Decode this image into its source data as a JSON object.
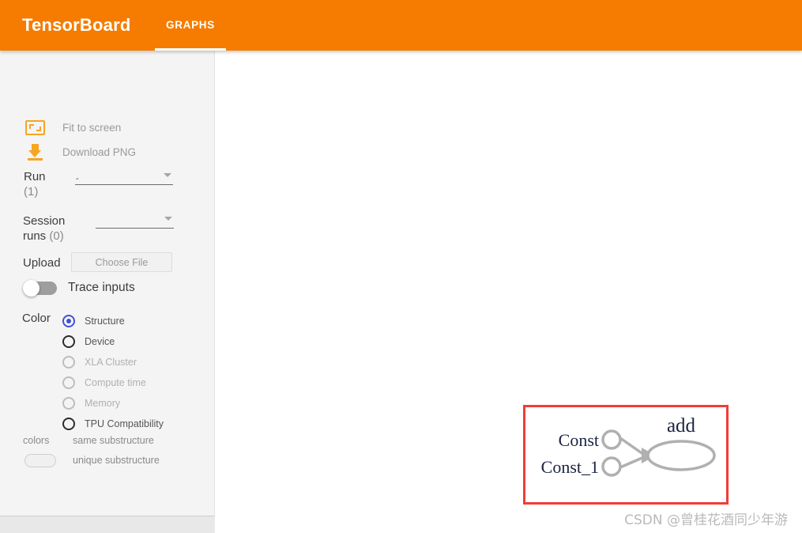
{
  "header": {
    "brand": "TensorBoard",
    "tabs": [
      {
        "label": "GRAPHS",
        "active": true
      }
    ]
  },
  "sidebar": {
    "actions": [
      {
        "label": "Fit to screen",
        "icon": "fit-to-screen-icon"
      },
      {
        "label": "Download PNG",
        "icon": "download-icon"
      }
    ],
    "run": {
      "label": "Run",
      "count": "(1)",
      "value": "-",
      "caret": "chevron-down-icon"
    },
    "session_runs": {
      "label": "Session",
      "label2": "runs",
      "count": "(0)",
      "value": "",
      "caret": "chevron-down-icon"
    },
    "upload": {
      "label": "Upload",
      "button": "Choose File"
    },
    "trace_inputs": {
      "label": "Trace inputs",
      "enabled": false
    },
    "color": {
      "label": "Color",
      "options": [
        {
          "label": "Structure",
          "selected": true,
          "disabled": false
        },
        {
          "label": "Device",
          "selected": false,
          "disabled": false
        },
        {
          "label": "XLA Cluster",
          "selected": false,
          "disabled": true
        },
        {
          "label": "Compute time",
          "selected": false,
          "disabled": true
        },
        {
          "label": "Memory",
          "selected": false,
          "disabled": true
        },
        {
          "label": "TPU Compatibility",
          "selected": false,
          "disabled": false
        }
      ],
      "accent": "#3f51d5"
    },
    "legend": {
      "label": "colors",
      "same": "same substructure",
      "unique": "unique substructure"
    }
  },
  "graph": {
    "highlight_color": "#f43b36",
    "nodes": [
      {
        "name": "Const",
        "shape": "circle",
        "label": "Const"
      },
      {
        "name": "Const_1",
        "shape": "circle",
        "label": "Const_1"
      },
      {
        "name": "add",
        "shape": "ellipse",
        "label": "add"
      }
    ],
    "edges": [
      {
        "from": "Const",
        "to": "add"
      },
      {
        "from": "Const_1",
        "to": "add"
      }
    ],
    "node_stroke": "#b0b0b0"
  },
  "watermark": {
    "text": "CSDN @曾桂花酒同少年游"
  }
}
